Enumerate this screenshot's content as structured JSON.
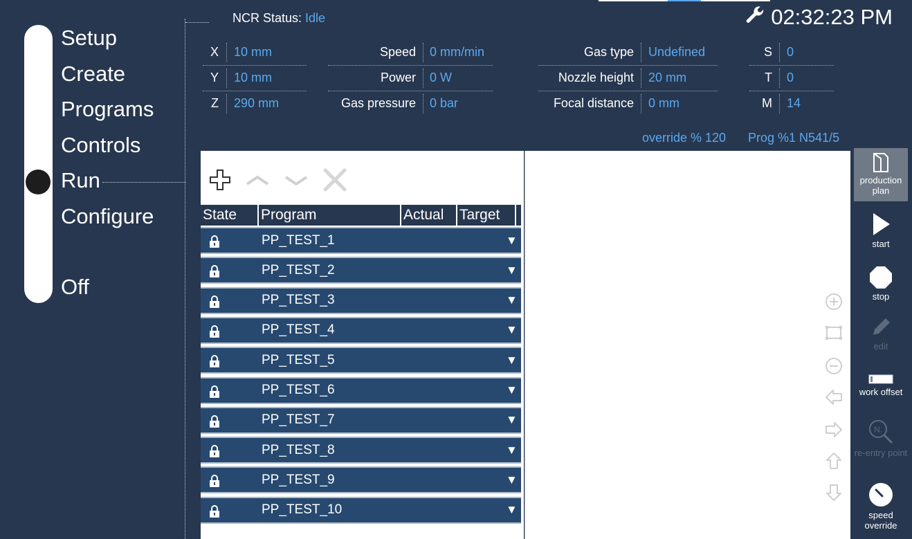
{
  "nav": {
    "items": [
      {
        "id": "setup",
        "label": "Setup"
      },
      {
        "id": "create",
        "label": "Create"
      },
      {
        "id": "programs",
        "label": "Programs"
      },
      {
        "id": "controls",
        "label": "Controls"
      },
      {
        "id": "run",
        "label": "Run",
        "active": true
      },
      {
        "id": "configure",
        "label": "Configure"
      },
      {
        "id": "off",
        "label": "Off"
      }
    ]
  },
  "header": {
    "status_label": "NCR Status:",
    "status_value": "Idle",
    "clock": "02:32:23 PM",
    "clock_icon": "wrench-icon"
  },
  "params": {
    "x": {
      "label": "X",
      "value": "10 mm"
    },
    "y": {
      "label": "Y",
      "value": "10 mm"
    },
    "z": {
      "label": "Z",
      "value": "290 mm"
    },
    "speed": {
      "label": "Speed",
      "value": "0 mm/min"
    },
    "power": {
      "label": "Power",
      "value": "0 W"
    },
    "gas_pressure": {
      "label": "Gas pressure",
      "value": "0 bar"
    },
    "gas_type": {
      "label": "Gas type",
      "value": "Undefined"
    },
    "nozzle_height": {
      "label": "Nozzle height",
      "value": "20 mm"
    },
    "focal_distance": {
      "label": "Focal distance",
      "value": "0 mm"
    },
    "s": {
      "label": "S",
      "value": "0"
    },
    "t": {
      "label": "T",
      "value": "0"
    },
    "m": {
      "label": "M",
      "value": "14"
    }
  },
  "info": {
    "override": "override % 120",
    "prog": "Prog %1 N541/5"
  },
  "toolbar": {
    "icons": [
      "plus-icon",
      "chevron-up-icon",
      "chevron-down-icon",
      "close-icon"
    ]
  },
  "grid": {
    "columns": [
      "State",
      "Program",
      "Actual",
      "Target"
    ],
    "rows": [
      {
        "program": "PP_TEST_1",
        "state_icon": "lock-icon"
      },
      {
        "program": "PP_TEST_2",
        "state_icon": "lock-icon"
      },
      {
        "program": "PP_TEST_3",
        "state_icon": "lock-icon"
      },
      {
        "program": "PP_TEST_4",
        "state_icon": "lock-icon"
      },
      {
        "program": "PP_TEST_5",
        "state_icon": "lock-icon"
      },
      {
        "program": "PP_TEST_6",
        "state_icon": "lock-icon"
      },
      {
        "program": "PP_TEST_7",
        "state_icon": "lock-icon"
      },
      {
        "program": "PP_TEST_8",
        "state_icon": "lock-icon"
      },
      {
        "program": "PP_TEST_9",
        "state_icon": "lock-icon"
      },
      {
        "program": "PP_TEST_10",
        "state_icon": "lock-icon"
      }
    ],
    "dropdown_glyph": "▼"
  },
  "preview_controls": [
    "zoom-in-icon",
    "fit-view-icon",
    "zoom-out-icon",
    "arrow-left-icon",
    "arrow-right-icon",
    "arrow-up-icon",
    "arrow-down-icon"
  ],
  "actions": {
    "production_plan": {
      "label": "production plan",
      "active": true
    },
    "start": {
      "label": "start"
    },
    "stop": {
      "label": "stop"
    },
    "edit": {
      "label": "edit",
      "disabled": true
    },
    "work_offset": {
      "label": "work offset"
    },
    "reentry": {
      "label": "re-entry point",
      "disabled": true
    },
    "speed_override": {
      "label": "speed override"
    }
  },
  "colors": {
    "background": "#27374f",
    "accent_value": "#5aa9ef",
    "row": "#27496f",
    "active_action": "#707a86"
  }
}
